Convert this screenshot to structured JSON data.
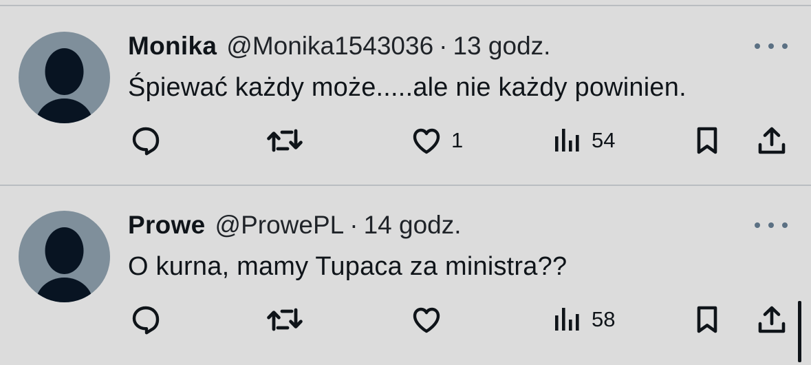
{
  "tweets": [
    {
      "name": "Monika",
      "handle": "@Monika1543036",
      "separator": "·",
      "time": "13 godz.",
      "text": "Śpiewać każdy może.....ale nie każdy powinien.",
      "likes": "1",
      "views": "54",
      "icons": [
        "reply-icon",
        "retweet-icon",
        "like-icon",
        "views-icon",
        "bookmark-icon",
        "share-icon",
        "more-icon"
      ]
    },
    {
      "name": "Prowe",
      "handle": "@ProwePL",
      "separator": "·",
      "time": "14 godz.",
      "text": "O kurna, mamy Tupaca za ministra??",
      "likes": "",
      "views": "58",
      "icons": [
        "reply-icon",
        "retweet-icon",
        "like-icon",
        "views-icon",
        "bookmark-icon",
        "share-icon",
        "more-icon"
      ]
    }
  ],
  "colors": {
    "background": "#dcdcdc",
    "text": "#0f1419",
    "avatar": "#7f8f9b",
    "silhouette": "#081422"
  }
}
